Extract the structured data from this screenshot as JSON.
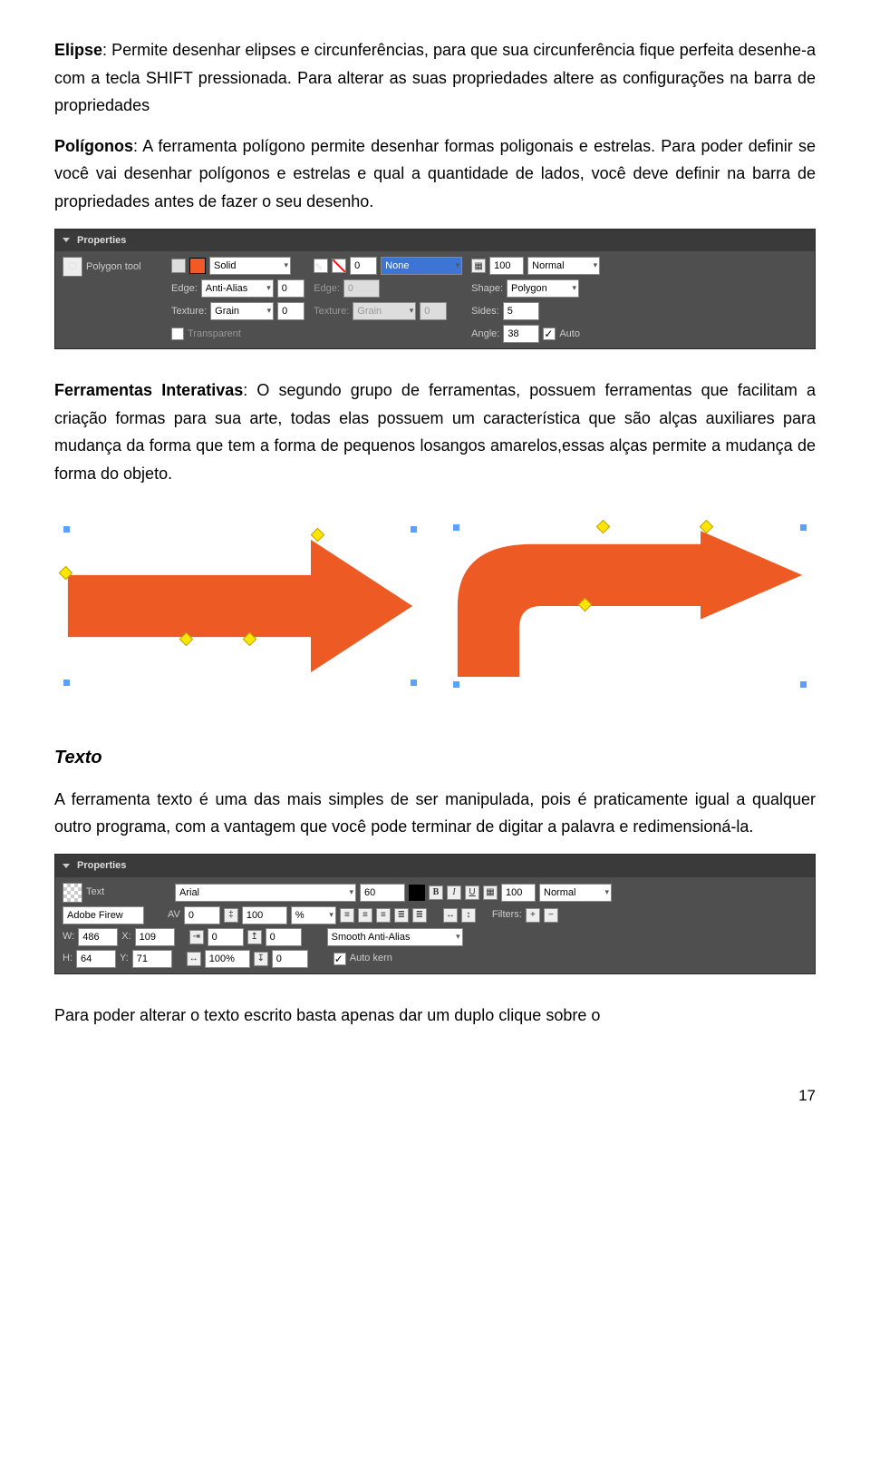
{
  "p1_label": "Elipse",
  "p1_text": ": Permite desenhar elipses e circunferências, para que sua circunferência fique perfeita desenhe-a com a tecla SHIFT pressionada. Para alterar as suas propriedades altere as configurações na barra de propriedades",
  "p2_label": "Polígonos",
  "p2_text": ": A ferramenta polígono permite desenhar formas poligonais e estrelas. Para poder definir se você vai desenhar polígonos e estrelas e qual a quantidade de lados, você deve definir na barra de propriedades antes de fazer o seu desenho.",
  "p3_label": "Ferramentas Interativas",
  "p3_text": ": O segundo grupo de ferramentas, possuem ferramentas que facilitam a criação formas para sua arte, todas elas possuem um característica que são alças auxiliares para mudança da forma que tem a forma de pequenos losangos amarelos,essas alças permite a mudança de forma do objeto.",
  "h_texto": "Texto",
  "p4_text": "A ferramenta texto é uma das mais simples de ser manipulada, pois é praticamente igual a qualquer outro programa, com a vantagem que você pode terminar de digitar a palavra e redimensioná-la.",
  "p5_text": "Para poder alterar o texto escrito basta apenas dar um duplo clique sobre o",
  "page_num": "17",
  "panel1": {
    "title": "Properties",
    "tool": "Polygon tool",
    "fillstyle": "Solid",
    "stroke": "0",
    "tip": "None",
    "opacity": "100",
    "blend": "Normal",
    "edge_lbl": "Edge:",
    "edge1": "Anti-Alias",
    "edge1_v": "0",
    "edge2_lbl": "Edge:",
    "edge2_v": "0",
    "shape_lbl": "Shape:",
    "shape": "Polygon",
    "texture_lbl": "Texture:",
    "texture": "Grain",
    "texture_v": "0",
    "texture2_lbl": "Texture:",
    "texture2": "Grain",
    "texture2_v": "0",
    "sides_lbl": "Sides:",
    "sides": "5",
    "transparent": "Transparent",
    "angle_lbl": "Angle:",
    "angle": "38",
    "auto": "Auto"
  },
  "panel2": {
    "title": "Properties",
    "tool": "Text",
    "sub": "Adobe Firew",
    "font": "Arial",
    "size": "60",
    "b": "B",
    "i": "I",
    "u": "U",
    "opacity": "100",
    "blend": "Normal",
    "av_lbl": "AV",
    "av": "0",
    "lh": "100",
    "pct": "%",
    "filters_lbl": "Filters:",
    "w_lbl": "W:",
    "w": "486",
    "x_lbl": "X:",
    "x": "109",
    "indent": "0",
    "lead": "0",
    "smooth": "Smooth Anti-Alias",
    "h_lbl": "H:",
    "h": "64",
    "y_lbl": "Y:",
    "y": "71",
    "zoom": "100%",
    "sp": "0",
    "autokern": "Auto kern"
  }
}
